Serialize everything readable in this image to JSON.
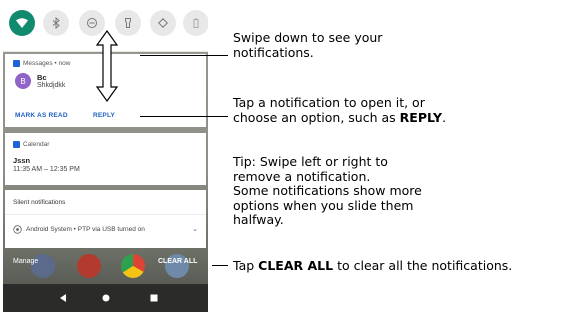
{
  "quick_settings": {
    "tiles": [
      "wifi-icon",
      "bluetooth-icon",
      "do-not-disturb-icon",
      "flashlight-icon",
      "auto-rotate-icon",
      "battery-saver-icon"
    ],
    "active_color": "#128a6e"
  },
  "notifications": {
    "messages": {
      "app": "Messages • now",
      "avatar_letter": "B",
      "sender": "Bc",
      "text": "Shkdjdkk",
      "actions": [
        "MARK AS READ",
        "REPLY"
      ]
    },
    "calendar": {
      "app": "Calendar",
      "title": "Jssn",
      "time": "11:35 AM – 12:35 PM"
    },
    "silent": {
      "header": "Silent notifications",
      "item": "Android System • PTP via USB turned on"
    },
    "bottom": {
      "manage": "Manage",
      "clear_all": "CLEAR ALL"
    }
  },
  "instructions": {
    "swipe_down": "Swipe down to see your notifications.",
    "tap_open_prefix": "Tap a notification to open it, or choose an option, such as",
    "tap_open_bold": "REPLY",
    "tap_open_suffix": ".",
    "tip": "Tip: Swipe left or right to remove a notification.",
    "more_options": "Some notifications  show more options when you slide them halfway.",
    "clear_prefix": "Tap",
    "clear_bold": "CLEAR ALL",
    "clear_suffix": "to clear all the notifications."
  },
  "colors": {
    "accent_blue": "#1f5fbf",
    "avatar_purple": "#8f63c7"
  }
}
